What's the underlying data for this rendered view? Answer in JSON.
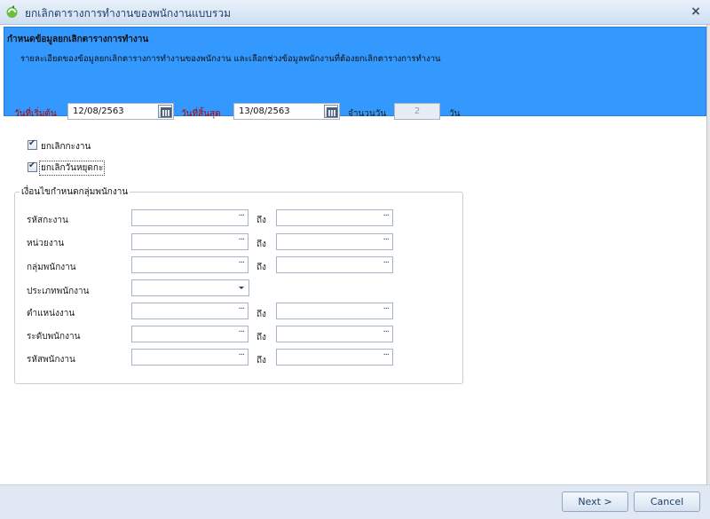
{
  "window": {
    "title": "ยกเลิกตารางการทำงานของพนักงานแบบรวม",
    "close_symbol": "×"
  },
  "banner": {
    "title": "กำหนดข้อมูลยกเลิกตารางการทำงาน",
    "description": "รายละเอียดของข้อมูลยกเลิกตารางการทำงานของพนักงาน และเลือกช่วงข้อมูลพนักงานที่ต้องยกเลิกตารางการทำงาน"
  },
  "dates": {
    "start_label": "วันที่เริ่มต้น",
    "start_value": "12/08/2563",
    "end_label": "วันที่สิ้นสุด",
    "end_value": "13/08/2563",
    "count_label": "จำนวนวัน",
    "count_value": "2",
    "count_unit": "วัน"
  },
  "options": {
    "cancel_schedule_label": "ยกเลิกกะงาน",
    "cancel_schedule_checked": true,
    "cancel_holiday_label": "ยกเลิกวันหยุดกะ",
    "cancel_holiday_checked": true
  },
  "group": {
    "title": "เงื่อนไขกำหนดกลุ่มพนักงาน",
    "to_label": "ถึง",
    "dots": "···",
    "rows": [
      {
        "label": "รหัสกะงาน",
        "from": "",
        "to": ""
      },
      {
        "label": "หน่วยงาน",
        "from": "",
        "to": ""
      },
      {
        "label": "กลุ่มพนักงาน",
        "from": "",
        "to": ""
      },
      {
        "label": "ประเภทพนักงาน",
        "value": ""
      },
      {
        "label": "ตำแหน่งงาน",
        "from": "",
        "to": ""
      },
      {
        "label": "ระดับพนักงาน",
        "from": "",
        "to": ""
      },
      {
        "label": "รหัสพนักงาน",
        "from": "",
        "to": ""
      }
    ]
  },
  "footer": {
    "next_label": "Next >",
    "cancel_label": "Cancel"
  },
  "colors": {
    "banner": "#3399ff",
    "required_label": "#b00000"
  }
}
